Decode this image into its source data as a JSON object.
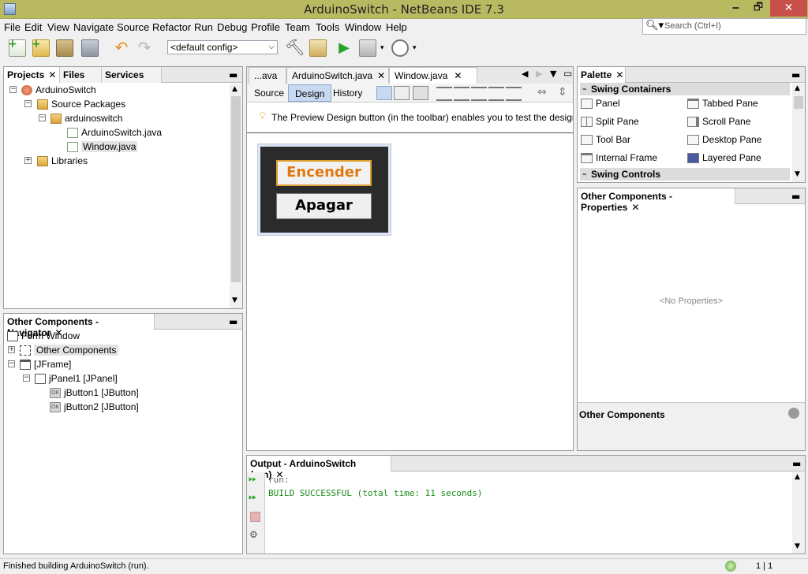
{
  "window": {
    "title": "ArduinoSwitch - NetBeans IDE 7.3",
    "minimize": "🗕",
    "maximize": "🗗",
    "close": "✕"
  },
  "menu": [
    "File",
    "Edit",
    "View",
    "Navigate",
    "Source",
    "Refactor",
    "Run",
    "Debug",
    "Profile",
    "Team",
    "Tools",
    "Window",
    "Help"
  ],
  "search": {
    "placeholder": "Search (Ctrl+I)"
  },
  "toolbar": {
    "config": "<default config>"
  },
  "projects": {
    "tabs": [
      "Projects",
      "Files",
      "Services"
    ],
    "tree": [
      "ArduinoSwitch",
      "Source Packages",
      "arduinoswitch",
      "ArduinoSwitch.java",
      "Window.java",
      "Libraries"
    ]
  },
  "navigator": {
    "title": "Other Components - Navigator",
    "tree": [
      "Form Window",
      "Other Components",
      "[JFrame]",
      "jPanel1 [JPanel]",
      "jButton1 [JButton]",
      "jButton2 [JButton]"
    ],
    "ok_badge": "OK"
  },
  "editor": {
    "tabs": [
      "...ava",
      "ArduinoSwitch.java",
      "Window.java"
    ],
    "subtabs": [
      "Source",
      "Design",
      "History"
    ],
    "hint": "The Preview Design button (in the toolbar) enables you to test the design of the",
    "button1": "Encender",
    "button2": "Apagar"
  },
  "palette": {
    "title": "Palette",
    "sections": [
      "Swing Containers",
      "Swing Controls"
    ],
    "items": [
      "Panel",
      "Tabbed Pane",
      "Split Pane",
      "Scroll Pane",
      "Tool Bar",
      "Desktop Pane",
      "Internal Frame",
      "Layered Pane"
    ]
  },
  "properties": {
    "title": "Other Components - Properties",
    "empty": "<No Properties>",
    "footer": "Other Components"
  },
  "output": {
    "title": "Output - ArduinoSwitch (run)",
    "lines": [
      "run:",
      "BUILD SUCCESSFUL (total time: 11 seconds)"
    ]
  },
  "status": {
    "message": "Finished building ArduinoSwitch (run).",
    "position": "1 | 1"
  },
  "colors": {
    "accent_orange": "#e07a10",
    "build_green": "#1a8a1a",
    "titlebar": "#b9b962",
    "close_red": "#c7504a"
  }
}
